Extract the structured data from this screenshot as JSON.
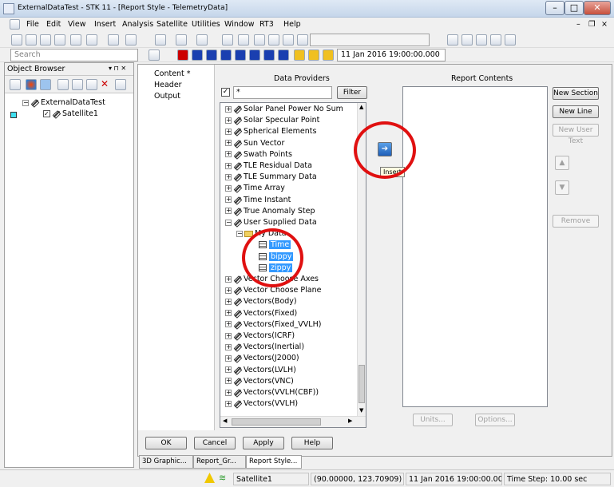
{
  "window": {
    "title": "ExternalDataTest - STK 11 - [Report Style - TelemetryData]",
    "min_glyph": "–",
    "max_glyph": "□",
    "close_glyph": "✕"
  },
  "menu": {
    "items": [
      "File",
      "Edit",
      "View",
      "Insert",
      "Analysis",
      "Satellite",
      "Utilities",
      "Window",
      "RT3",
      "Help"
    ],
    "mdi": {
      "min": "–",
      "restore": "❐",
      "close": "×"
    }
  },
  "toolbar": {
    "search_placeholder": "Search",
    "date_value": "11 Jan 2016 19:00:00.000"
  },
  "object_browser": {
    "title": "Object Browser",
    "pin": "▾ ⊓ ✕",
    "tree": {
      "root": "ExternalDataTest",
      "child": "Satellite1"
    }
  },
  "dialog": {
    "nav": [
      {
        "label": "Content *"
      },
      {
        "label": "Header"
      },
      {
        "label": "Output"
      }
    ],
    "data_providers": {
      "title": "Data Providers",
      "filter_value": "*",
      "filter_button": "Filter",
      "items": [
        "Solar Panel Power No Sum",
        "Solar Specular Point",
        "Spherical Elements",
        "Sun Vector",
        "Swath Points",
        "TLE Residual Data",
        "TLE Summary Data",
        "Time Array",
        "Time Instant",
        "True Anomaly Step",
        "User Supplied Data"
      ],
      "sub_folder": "My Data",
      "sub_items": [
        "Time",
        "bippy",
        "zippy"
      ],
      "items_after": [
        "Vector Choose Axes",
        "Vector Choose Plane",
        "Vectors(Body)",
        "Vectors(Fixed)",
        "Vectors(Fixed_VVLH)",
        "Vectors(ICRF)",
        "Vectors(Inertial)",
        "Vectors(J2000)",
        "Vectors(LVLH)",
        "Vectors(VNC)",
        "Vectors(VVLH(CBF))",
        "Vectors(VVLH)"
      ]
    },
    "report_contents": {
      "title": "Report Contents"
    },
    "side_buttons": {
      "new_section": "New Section",
      "new_line": "New Line",
      "new_user_text": "New User Text",
      "remove": "Remove"
    },
    "insert_tooltip": "Insert",
    "bottom_buttons": {
      "units": "Units...",
      "options": "Options..."
    },
    "footer": {
      "ok": "OK",
      "cancel": "Cancel",
      "apply": "Apply",
      "help": "Help"
    }
  },
  "tabs": [
    "3D Graphic...",
    "Report_Gr...",
    "Report Style..."
  ],
  "status": {
    "object": "Satellite1",
    "position": "(90.00000, 123.70909)",
    "time": "11 Jan 2016 19:00:00.000",
    "step": "Time Step: 10.00 sec"
  },
  "colors": {
    "highlight": "#3399ff",
    "annotation": "#e01010"
  }
}
